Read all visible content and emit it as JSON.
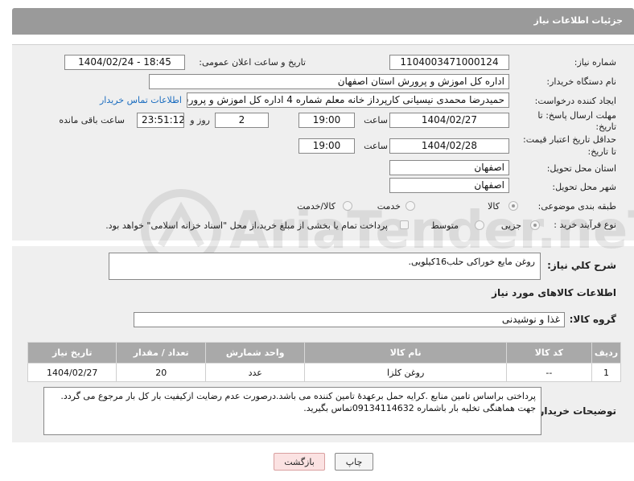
{
  "header": {
    "title": "جزئیات اطلاعات نیاز"
  },
  "form": {
    "need_number_label": "شماره نیاز:",
    "need_number": "1104003471000124",
    "announce_label": "تاریخ و ساعت اعلان عمومی:",
    "announce_value": "1404/02/24 - 18:45",
    "buyer_org_label": "نام دستگاه خریدار:",
    "buyer_org": "اداره کل اموزش و پرورش استان اصفهان",
    "requester_label": "ایجاد کننده درخواست:",
    "requester": "حمیدرضا محمدی نیسیانی کارپرداز خانه معلم شماره 4 اداره کل اموزش و پرورش",
    "contact_link": "اطلاعات تماس خریدار",
    "deadline_label_1": "مهلت ارسال پاسخ: تا",
    "deadline_label_2": "تاریخ:",
    "deadline_date": "1404/02/27",
    "time_label": "ساعت",
    "deadline_time": "19:00",
    "days_value": "2",
    "days_label": "روز و",
    "remaining_value": "23:51:12",
    "remaining_label": "ساعت باقی مانده",
    "price_label_1": "حداقل تاریخ اعتبار قیمت:",
    "price_label_2": "تا تاریخ:",
    "price_date": "1404/02/28",
    "price_time_label": "ساعت",
    "price_time": "19:00",
    "province_label": "استان محل تحویل:",
    "province": "اصفهان",
    "city_label": "شهر محل تحویل:",
    "city": "اصفهان",
    "category_label": "طبقه بندی موضوعی:",
    "category_options": [
      "کالا",
      "خدمت",
      "کالا/خدمت"
    ],
    "process_label": "نوع فرآیند خرید :",
    "process_options": [
      "جزیی",
      "متوسط"
    ],
    "payment_note": "پرداخت تمام یا بخشی از مبلغ خرید،از محل \"اسناد خزانه اسلامی\" خواهد بود."
  },
  "summary": {
    "label": "شرح کلي نياز:",
    "value": "روغن مایع خوراکی حلب16کیلویی."
  },
  "goods": {
    "section_title": "اطلاعات کالاهای مورد نیاز",
    "group_label": "گروه کالا:",
    "group_value": "غذا و نوشیدنی",
    "table": {
      "headers": [
        "ردیف",
        "کد کالا",
        "نام کالا",
        "واحد شمارش",
        "تعداد / مقدار",
        "تاریخ نیاز"
      ],
      "rows": [
        [
          "1",
          "--",
          "روغن کلزا",
          "عدد",
          "20",
          "1404/02/27"
        ]
      ]
    }
  },
  "buyer_notes": {
    "label": "توضیحات خریدار:",
    "value": "پرداختی براساس تامین منابع .کرایه حمل برعهدۀ تامین کننده می باشد.درصورت عدم رضایت ازکیفیت بار کل بار مرجوع می گردد.  جهت هماهنگی تخلیه بار باشماره 09134114632تماس بگیرید."
  },
  "buttons": {
    "print": "چاپ",
    "back": "بازگشت"
  },
  "watermark": "AriaTender.neT"
}
